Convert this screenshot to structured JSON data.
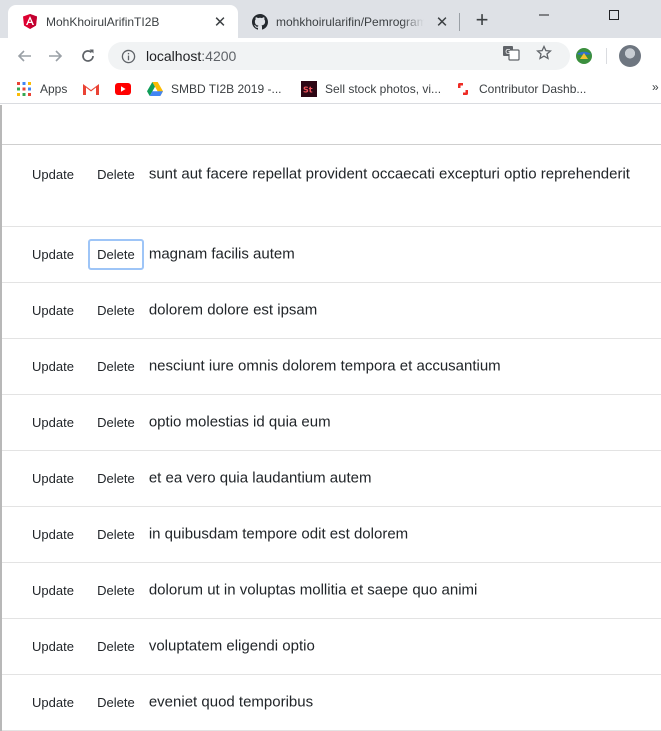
{
  "browser": {
    "tabs": [
      {
        "title": "MohKhoirulArifinTI2B",
        "icon": "angular-icon",
        "active": true
      },
      {
        "title": "mohkhoirularifin/Pemrograman",
        "icon": "github-icon",
        "active": false
      }
    ],
    "address": {
      "host": "localhost",
      "port": ":4200"
    },
    "bookmarks": [
      {
        "label": "Apps",
        "icon": "apps-grid-icon"
      },
      {
        "label": "",
        "icon": "gmail-icon"
      },
      {
        "label": "",
        "icon": "youtube-icon"
      },
      {
        "label": "SMBD TI2B 2019 -...",
        "icon": "drive-icon"
      },
      {
        "label": "Sell stock photos, vi...",
        "icon": "adobe-stock-icon"
      },
      {
        "label": "Contributor Dashb...",
        "icon": "shutterstock-icon"
      }
    ],
    "bookmarks_more": "»"
  },
  "list": {
    "update_label": "Update",
    "delete_label": "Delete",
    "items": [
      "sunt aut facere repellat provident occaecati excepturi optio reprehenderit",
      "magnam facilis autem",
      "dolorem dolore est ipsam",
      "nesciunt iure omnis dolorem tempora et accusantium",
      "optio molestias id quia eum",
      "et ea vero quia laudantium autem",
      "in quibusdam tempore odit est dolorem",
      "dolorum ut in voluptas mollitia et saepe quo animi",
      "voluptatem eligendi optio",
      "eveniet quod temporibus"
    ]
  }
}
